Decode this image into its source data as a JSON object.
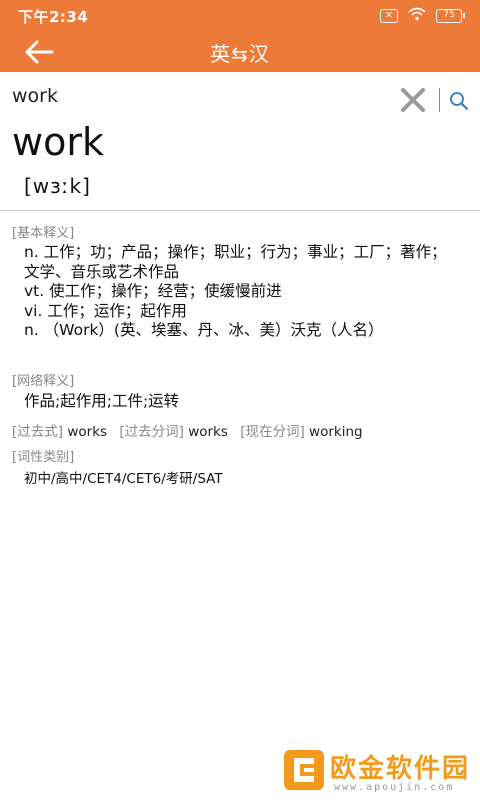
{
  "status_bar": {
    "time": "下午2:34",
    "notification_icon": "x-box-icon",
    "wifi_icon": "wifi-icon",
    "battery_level": "75"
  },
  "app_bar": {
    "title": "英⇆汉",
    "back_icon": "arrow-left-icon"
  },
  "search": {
    "query": "work",
    "clear_icon": "close-icon",
    "search_icon": "search-icon"
  },
  "entry": {
    "headword": "work",
    "phonetic": "[wɜːk]",
    "basic": {
      "label": "[基本释义]",
      "lines": [
        "n. 工作；功；产品；操作；职业；行为；事业；工厂；著作；",
        "文学、音乐或艺术作品",
        "vt. 使工作；操作；经营；使缓慢前进",
        "vi. 工作；运作；起作用",
        "n. （Work）(英、埃塞、丹、冰、美）沃克（人名）"
      ]
    },
    "web": {
      "label": "[网络释义]",
      "value": "作品;起作用;工件;运转"
    },
    "forms": [
      {
        "label": "[过去式]",
        "value": "works"
      },
      {
        "label": "[过去分词]",
        "value": "works"
      },
      {
        "label": "[现在分词]",
        "value": "working"
      }
    ],
    "category": {
      "label": "[词性类别]",
      "value": "初中/高中/CET4/CET6/考研/SAT"
    }
  },
  "watermark": {
    "text": "欧金软件园",
    "url": "www.apoujin.com",
    "color": "#f29a1c"
  },
  "colors": {
    "accent": "#ee7a3a"
  }
}
